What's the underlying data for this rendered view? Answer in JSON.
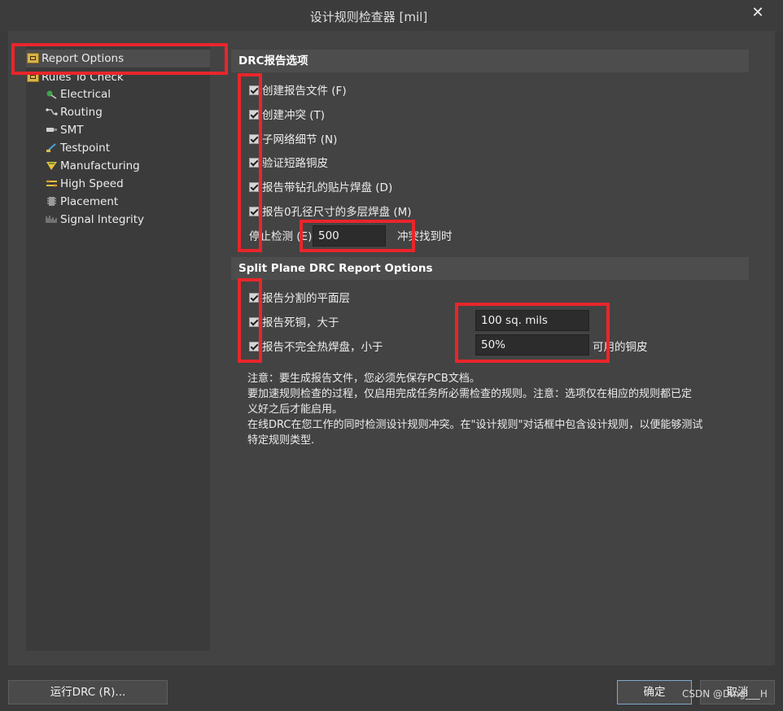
{
  "window": {
    "title": "设计规则检查器 [mil]",
    "close_glyph": "✕"
  },
  "tree": {
    "items": [
      {
        "label": "Report Options",
        "icon": "folder-icon"
      },
      {
        "label": "Rules To Check",
        "icon": "folder-icon"
      },
      {
        "label": "Electrical",
        "icon": "electrical-icon"
      },
      {
        "label": "Routing",
        "icon": "routing-icon"
      },
      {
        "label": "SMT",
        "icon": "smt-icon"
      },
      {
        "label": "Testpoint",
        "icon": "testpoint-icon"
      },
      {
        "label": "Manufacturing",
        "icon": "manufacturing-icon"
      },
      {
        "label": "High Speed",
        "icon": "high-speed-icon"
      },
      {
        "label": "Placement",
        "icon": "placement-icon"
      },
      {
        "label": "Signal Integrity",
        "icon": "signal-integrity-icon"
      }
    ]
  },
  "drc": {
    "header": "DRC报告选项",
    "options": [
      {
        "label": "创建报告文件 (F)",
        "checked": true
      },
      {
        "label": "创建冲突 (T)",
        "checked": true
      },
      {
        "label": "子网络细节 (N)",
        "checked": true
      },
      {
        "label": "验证短路铜皮",
        "checked": true
      },
      {
        "label": "报告带钻孔的贴片焊盘 (D)",
        "checked": true
      },
      {
        "label": "报告0孔径尺寸的多层焊盘 (M)",
        "checked": true
      }
    ],
    "stop_prefix": "停止检测 (E)",
    "stop_value": "500",
    "stop_suffix": "冲突找到时"
  },
  "split": {
    "header": "Split Plane DRC Report Options",
    "options": [
      {
        "label": "报告分割的平面层",
        "checked": true
      },
      {
        "label": "报告死铜，大于",
        "checked": true
      },
      {
        "label": "报告不完全热焊盘，小于",
        "checked": true
      }
    ],
    "dead_copper_value": "100 sq. mils",
    "thermal_value": "50%",
    "thermal_suffix": "可用的铜皮"
  },
  "notes": [
    "注意：要生成报告文件，您必须先保存PCB文档。",
    "要加速规则检查的过程，仅启用完成任务所必需检查的规则。注意：选项仅在相应的规则都已定",
    "义好之后才能启用。",
    "在线DRC在您工作的同时检测设计规则冲突。在\"设计规则\"对话框中包含设计规则，以便能够测试",
    "特定规则类型."
  ],
  "buttons": {
    "run": "运行DRC (R)...",
    "ok": "确定",
    "cancel": "取消"
  },
  "watermark": "CSDN @Ding___H",
  "colors": {
    "highlight": "#e8262b",
    "background": "#3a3a3a",
    "panel": "#434343"
  }
}
